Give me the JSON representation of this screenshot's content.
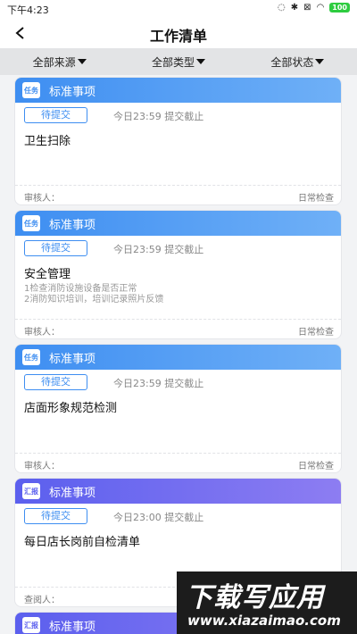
{
  "status_bar": {
    "time": "下午4:23",
    "battery": "100"
  },
  "nav": {
    "title": "工作清单"
  },
  "filters": [
    {
      "label": "全部来源"
    },
    {
      "label": "全部类型"
    },
    {
      "label": "全部状态"
    }
  ],
  "cards": [
    {
      "tag": "任务",
      "header": "标准事项",
      "status": "待提交",
      "deadline": "今日23:59 提交截止",
      "title": "卫生扫除",
      "desc_1": "",
      "desc_2": "",
      "reviewer": "审核人：",
      "category": "日常检查"
    },
    {
      "tag": "任务",
      "header": "标准事项",
      "status": "待提交",
      "deadline": "今日23:59 提交截止",
      "title": "安全管理",
      "desc_1": "1检查消防设施设备是否正常",
      "desc_2": "2消防知识培训，培训记录照片反馈",
      "reviewer": "审核人：",
      "category": "日常检查"
    },
    {
      "tag": "任务",
      "header": "标准事项",
      "status": "待提交",
      "deadline": "今日23:59 提交截止",
      "title": "店面形象规范检测",
      "desc_1": "",
      "desc_2": "",
      "reviewer": "审核人：",
      "category": "日常检查"
    },
    {
      "tag": "汇报",
      "header": "标准事项",
      "status": "待提交",
      "deadline": "今日23:00 提交截止",
      "title": "每日店长岗前自检清单",
      "desc_1": "",
      "desc_2": "",
      "reviewer": "查阅人：",
      "category": ""
    },
    {
      "tag": "汇报",
      "header": "标准事项"
    }
  ],
  "watermark": {
    "main": "下载写应用",
    "url": "www.xiazaimao.com"
  },
  "colors": {
    "blue": "#3e8ef1",
    "purple": "#5b5fee"
  }
}
